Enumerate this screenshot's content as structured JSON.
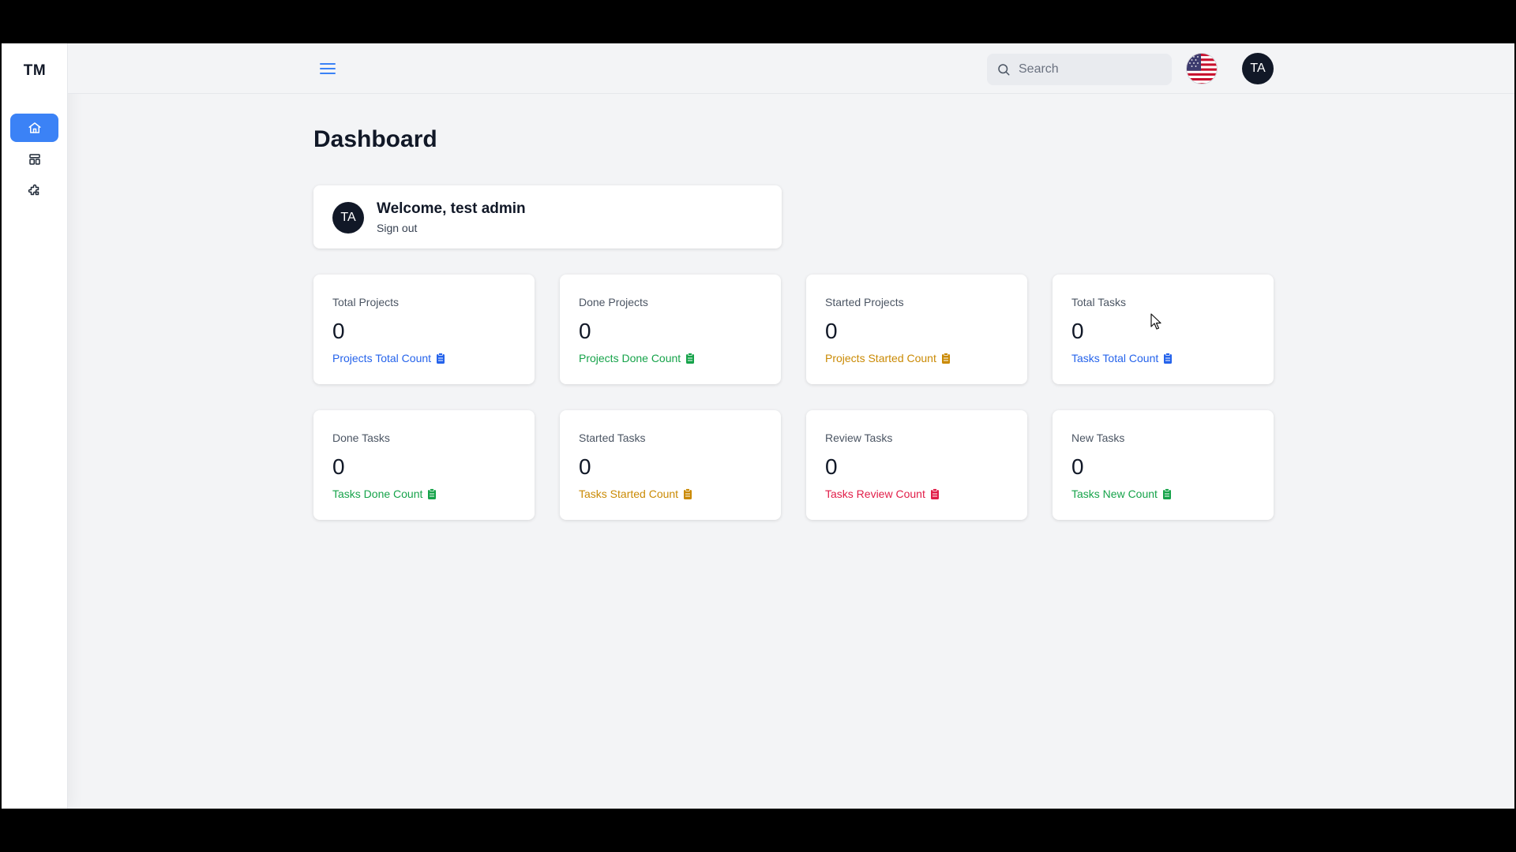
{
  "sidebar": {
    "logo": "TM",
    "items": [
      {
        "icon": "home-icon",
        "active": true
      },
      {
        "icon": "layout-icon",
        "active": false
      },
      {
        "icon": "puzzle-icon",
        "active": false
      }
    ]
  },
  "header": {
    "search_placeholder": "Search",
    "language_flag": "us-flag-icon",
    "avatar_initials": "TA"
  },
  "main": {
    "title": "Dashboard",
    "welcome": {
      "avatar_initials": "TA",
      "greeting": "Welcome, test admin",
      "sign_out": "Sign out"
    },
    "stats": [
      {
        "label": "Total Projects",
        "value": "0",
        "link": "Projects Total Count",
        "color": "#2563eb"
      },
      {
        "label": "Done Projects",
        "value": "0",
        "link": "Projects Done Count",
        "color": "#16a34a"
      },
      {
        "label": "Started Projects",
        "value": "0",
        "link": "Projects Started Count",
        "color": "#ca8a04"
      },
      {
        "label": "Total Tasks",
        "value": "0",
        "link": "Tasks Total Count",
        "color": "#2563eb"
      },
      {
        "label": "Done Tasks",
        "value": "0",
        "link": "Tasks Done Count",
        "color": "#16a34a"
      },
      {
        "label": "Started Tasks",
        "value": "0",
        "link": "Tasks Started Count",
        "color": "#ca8a04"
      },
      {
        "label": "Review Tasks",
        "value": "0",
        "link": "Tasks Review Count",
        "color": "#e11d48"
      },
      {
        "label": "New Tasks",
        "value": "0",
        "link": "Tasks New Count",
        "color": "#16a34a"
      }
    ]
  }
}
